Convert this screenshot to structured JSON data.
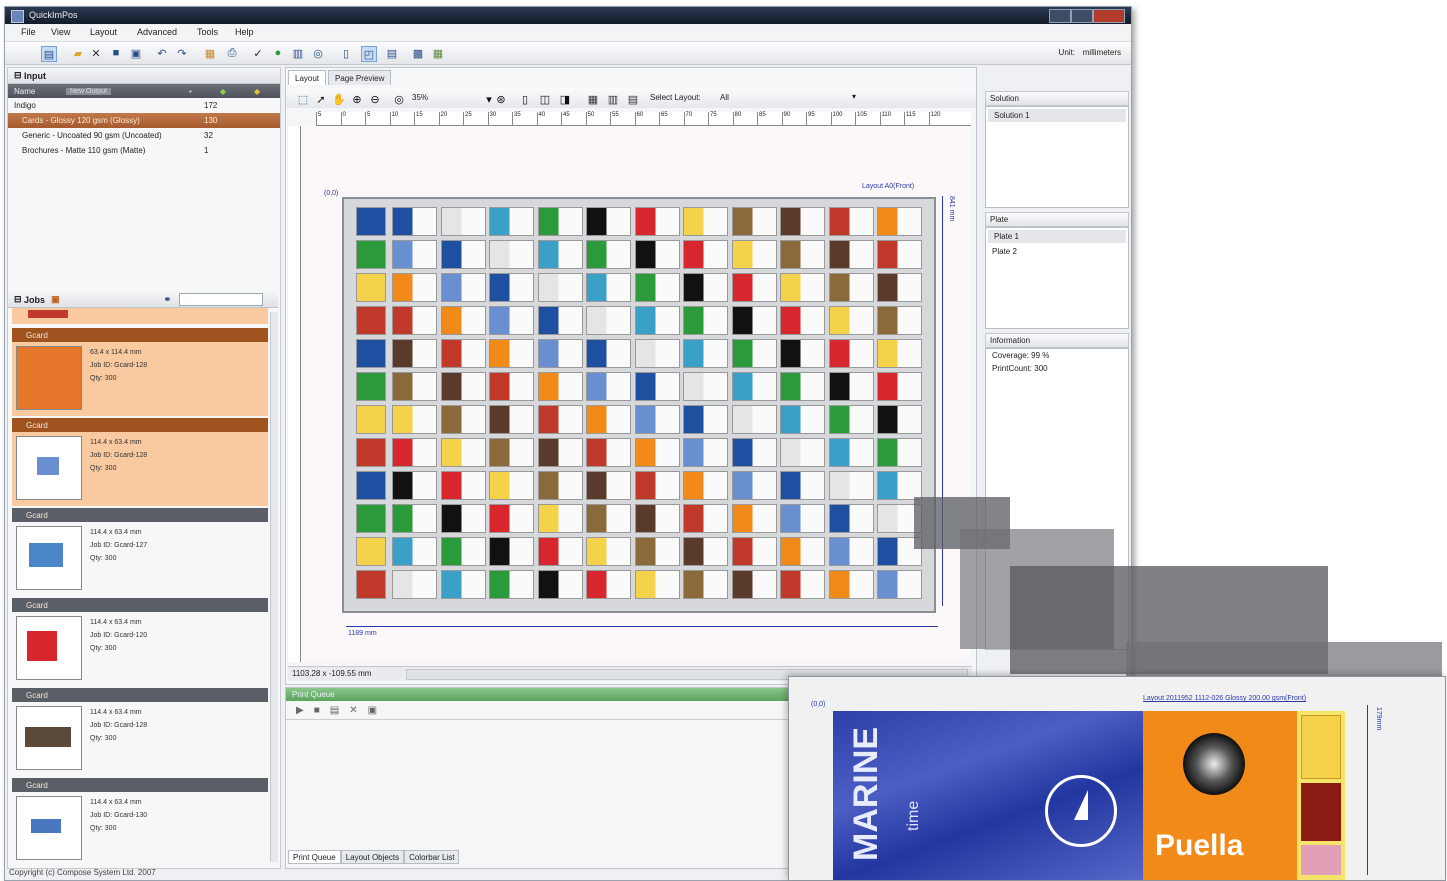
{
  "window": {
    "title": "QuickImPos"
  },
  "menu": [
    "File",
    "View",
    "Layout",
    "Advanced",
    "Tools",
    "Help"
  ],
  "toolbar": {
    "unit_label": "Unit:",
    "unit_value": "millimeters"
  },
  "input_panel": {
    "title": "Input",
    "tooltip": "New Output",
    "column_name": "Name",
    "rows": [
      {
        "name": "Indigo",
        "qty": "172"
      },
      {
        "name": "Cards - Glossy 120 gsm (Glossy)",
        "qty": "130",
        "selected": true
      },
      {
        "name": "Generic - Uncoated 90 gsm (Uncoated)",
        "qty": "32"
      },
      {
        "name": "Brochures - Matte 110 gsm (Matte)",
        "qty": "1"
      }
    ]
  },
  "jobs_panel": {
    "title": "Jobs",
    "jobs": [
      {
        "header": "Gcard",
        "size": "63.4 x 114.4 mm",
        "id": "Job ID: Gcard-128",
        "qty": "Qty: 300",
        "highlight": true
      },
      {
        "header": "Gcard",
        "size": "114.4 x 63.4 mm",
        "id": "Job ID: Gcard-128",
        "qty": "Qty: 300",
        "highlight": true
      },
      {
        "header": "Gcard",
        "size": "114.4 x 63.4 mm",
        "id": "Job ID: Gcard-127",
        "qty": "Qty: 300",
        "highlight": false
      },
      {
        "header": "Gcard",
        "size": "114.4 x 63.4 mm",
        "id": "Job ID: Gcard-120",
        "qty": "Qty: 300",
        "highlight": false
      },
      {
        "header": "Gcard",
        "size": "114.4 x 63.4 mm",
        "id": "Job ID: Gcard-128",
        "qty": "Qty: 300",
        "highlight": false
      },
      {
        "header": "Gcard",
        "size": "114.4 x 63.4 mm",
        "id": "Job ID: Gcard-130",
        "qty": "Qty: 300",
        "highlight": false
      }
    ]
  },
  "center": {
    "tabs": [
      "Layout",
      "Page Preview"
    ],
    "zoom": "35%",
    "select_layout_label": "Select Layout:",
    "select_layout_value": "All",
    "ruler": [
      "5",
      "0",
      "5",
      "10",
      "15",
      "20",
      "25",
      "30",
      "35",
      "40",
      "45",
      "50",
      "55",
      "60",
      "65",
      "70",
      "75",
      "80",
      "85",
      "90",
      "95",
      "100",
      "105",
      "110",
      "115",
      "120"
    ],
    "origin": "(0,0)",
    "layout_caption": "Layout A0(Front)",
    "width_dim": "1189 mm",
    "height_dim": "841 mm",
    "coords": "1103.28 x -109.55 mm"
  },
  "right_panel": {
    "solution_title": "Solution",
    "solution_items": [
      "Solution 1"
    ],
    "plate_title": "Plate",
    "plate_items": [
      "Plate 1",
      "Plate 2"
    ],
    "info_title": "Information",
    "coverage": "Coverage: 99 %",
    "printcount": "PrintCount: 300"
  },
  "print_queue": {
    "title": "Print Queue",
    "tabs": [
      "Print Queue",
      "Layout Objects",
      "Colorbar List"
    ]
  },
  "statusbar": "Copyright (c) Compose System Ltd. 2007",
  "preview": {
    "origin": "(0,0)",
    "caption": "Layout 2011952 1112-026 Glossy 200.00 gsm(Front)",
    "height_dim": "179mm",
    "text_marine": "MARINE",
    "text_time": "time",
    "text_puella": "Puella"
  }
}
